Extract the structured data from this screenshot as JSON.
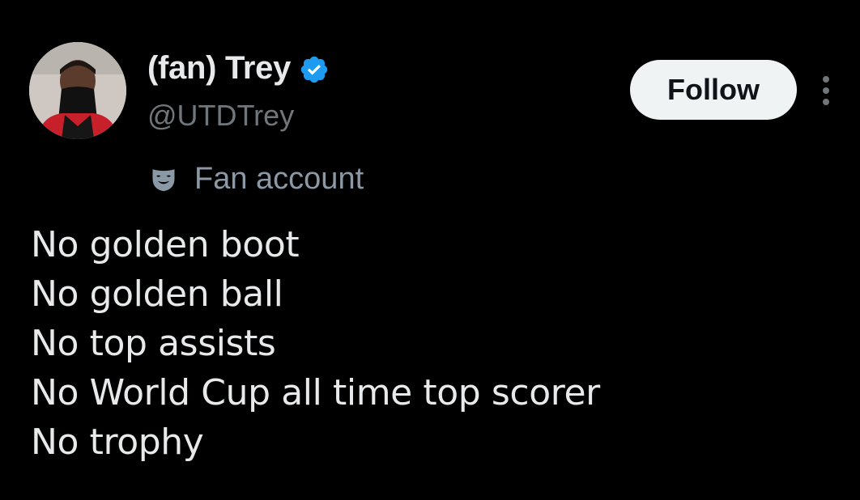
{
  "tweet": {
    "author": {
      "display_name": "(fan) Trey",
      "handle": "@UTDTrey",
      "verified": true,
      "avatar_icon": "user-avatar"
    },
    "follow_label": "Follow",
    "more_icon": "more-vertical-icon",
    "account_label": {
      "icon": "theater-mask-icon",
      "text": "Fan account"
    },
    "lines": [
      "No golden boot",
      "No golden ball",
      "No top assists",
      "No World Cup all time top scorer",
      "No trophy"
    ]
  },
  "colors": {
    "background": "#000000",
    "primary_text": "#e7e9ea",
    "secondary_text": "#71767b",
    "verified_badge": "#1d9bf0",
    "follow_button_bg": "#eff3f4",
    "follow_button_text": "#0f1419"
  }
}
